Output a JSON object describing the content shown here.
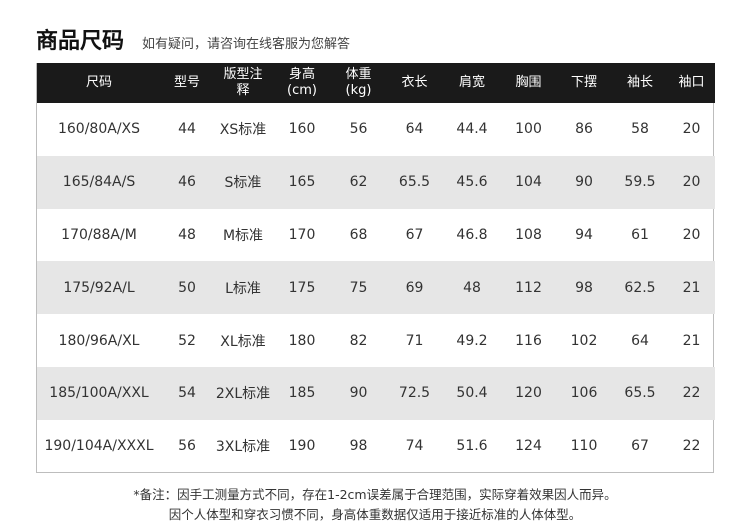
{
  "header": {
    "title": "商品尺码",
    "subtitle": "如有疑问，请咨询在线客服为您解答"
  },
  "table": {
    "headers": [
      {
        "line1": "尺码",
        "line2": ""
      },
      {
        "line1": "型号",
        "line2": ""
      },
      {
        "line1": "版型注",
        "line2": "释"
      },
      {
        "line1": "身高",
        "line2": "(cm)"
      },
      {
        "line1": "体重",
        "line2": "(kg)"
      },
      {
        "line1": "衣长",
        "line2": ""
      },
      {
        "line1": "肩宽",
        "line2": ""
      },
      {
        "line1": "胸围",
        "line2": ""
      },
      {
        "line1": "下摆",
        "line2": ""
      },
      {
        "line1": "袖长",
        "line2": ""
      },
      {
        "line1": "袖口",
        "line2": ""
      }
    ],
    "rows": [
      [
        "160/80A/XS",
        "44",
        "XS标准",
        "160",
        "56",
        "64",
        "44.4",
        "100",
        "86",
        "58",
        "20"
      ],
      [
        "165/84A/S",
        "46",
        "S标准",
        "165",
        "62",
        "65.5",
        "45.6",
        "104",
        "90",
        "59.5",
        "20"
      ],
      [
        "170/88A/M",
        "48",
        "M标准",
        "170",
        "68",
        "67",
        "46.8",
        "108",
        "94",
        "61",
        "20"
      ],
      [
        "175/92A/L",
        "50",
        "L标准",
        "175",
        "75",
        "69",
        "48",
        "112",
        "98",
        "62.5",
        "21"
      ],
      [
        "180/96A/XL",
        "52",
        "XL标准",
        "180",
        "82",
        "71",
        "49.2",
        "116",
        "102",
        "64",
        "21"
      ],
      [
        "185/100A/XXL",
        "54",
        "2XL标准",
        "185",
        "90",
        "72.5",
        "50.4",
        "120",
        "106",
        "65.5",
        "22"
      ],
      [
        "190/104A/XXXL",
        "56",
        "3XL标准",
        "190",
        "98",
        "74",
        "51.6",
        "124",
        "110",
        "67",
        "22"
      ]
    ]
  },
  "note": {
    "line1": "*备注：因手工测量方式不同，存在1-2cm误差属于合理范围，实际穿着效果因人而异。",
    "line2": "因个人体型和穿衣习惯不同，身高体重数据仅适用于接近标准的人体体型。"
  },
  "colors": {
    "header_bg": "#1a1a1a",
    "alt_row_bg": "#e6e6e6"
  }
}
